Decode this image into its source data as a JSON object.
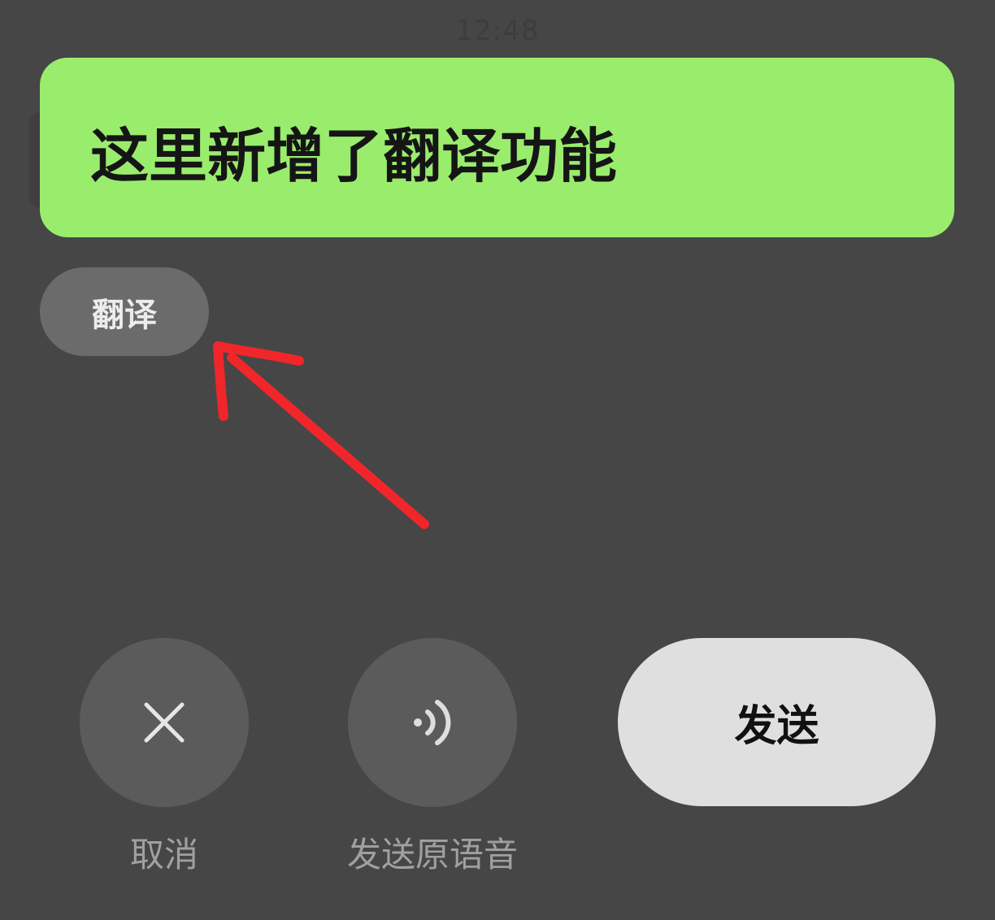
{
  "status_bar": {
    "time": "12:48"
  },
  "tooltip": {
    "text": "这里新增了翻译功能"
  },
  "translate_button": {
    "label": "翻译"
  },
  "actions": {
    "cancel_label": "取消",
    "send_original_voice_label": "发送原语音",
    "send_label": "发送"
  },
  "icons": {
    "cancel": "close-icon",
    "voice": "sound-wave-icon",
    "annotation": "red-arrow-annotation"
  },
  "colors": {
    "background": "#464646",
    "tooltip": "#9aec6d",
    "annotation_arrow": "#f0262b"
  }
}
